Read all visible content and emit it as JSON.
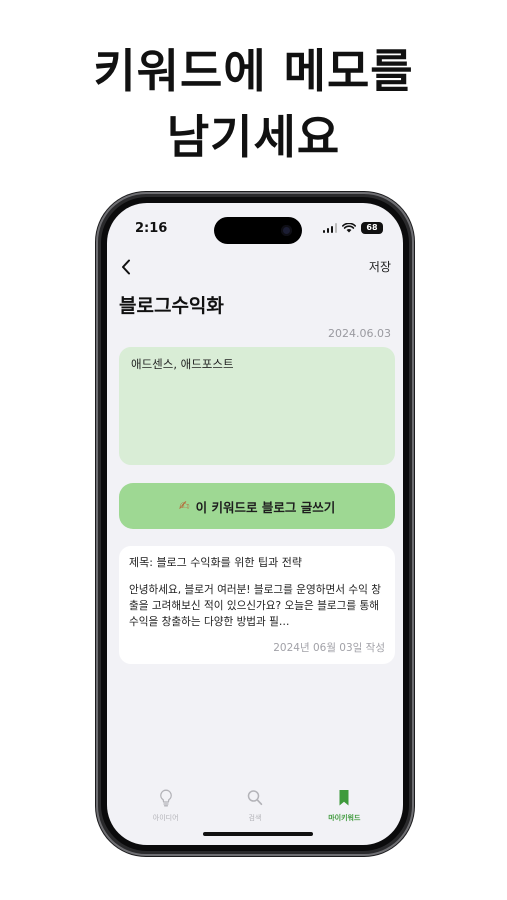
{
  "headline": {
    "line1": "키워드에 메모를",
    "line2": "남기세요"
  },
  "status_bar": {
    "time": "2:16",
    "battery": "68"
  },
  "nav": {
    "back_icon": "chevron-left-icon",
    "save_label": "저장"
  },
  "keyword": {
    "title": "블로그수익화",
    "date": "2024.06.03"
  },
  "memo": {
    "text": "애드센스, 애드포스트"
  },
  "write_button": {
    "icon": "✍",
    "label": "이 키워드로 블로그 글쓰기"
  },
  "post": {
    "title": "제목: 블로그 수익화를 위한 팁과 전략",
    "body": "안녕하세요, 블로거 여러분! 블로그를 운영하면서 수익 창출을 고려해보신 적이 있으신가요? 오늘은 블로그를 통해 수익을 창출하는 다양한 방법과 필…",
    "meta": "2024년 06월 03일 작성"
  },
  "tabs": [
    {
      "label": "아이디어",
      "icon": "lightbulb-icon",
      "active": false
    },
    {
      "label": "검색",
      "icon": "search-icon",
      "active": false
    },
    {
      "label": "마이키워드",
      "icon": "bookmark-icon",
      "active": true
    }
  ],
  "colors": {
    "memo_bg": "#d9edd6",
    "button_bg": "#9ed893",
    "active_tab": "#3f9a3c",
    "screen_bg": "#f2f2f6"
  }
}
